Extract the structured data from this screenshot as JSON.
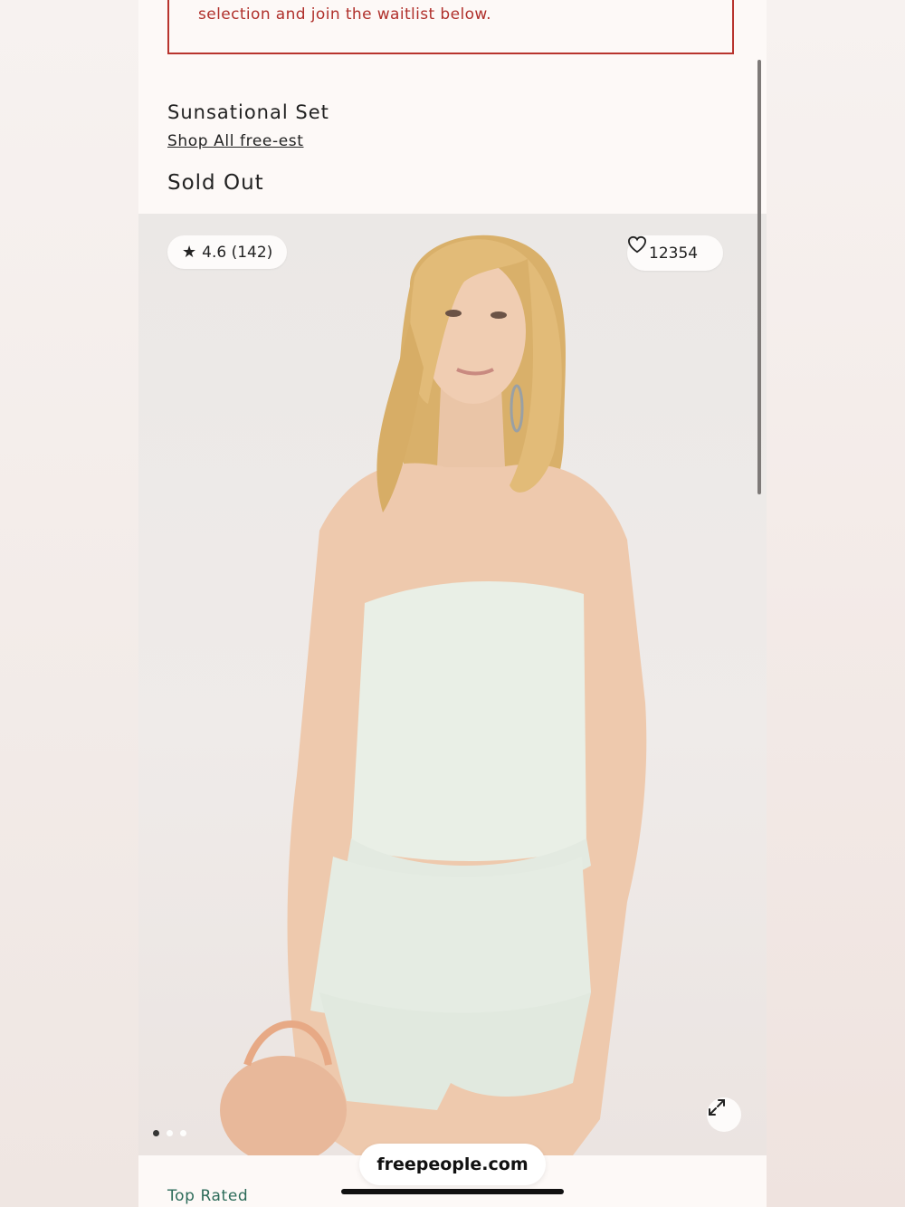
{
  "alert": {
    "text": "selection and join the waitlist below."
  },
  "product": {
    "title": "Sunsational Set",
    "brand_link": "Shop All free-est",
    "status": "Sold Out"
  },
  "gallery": {
    "rating": "4.6 (142)",
    "favorites_count": "12354",
    "icons": {
      "star": "star-icon",
      "heart": "heart-icon",
      "expand": "expand-icon"
    },
    "slide_count": 3,
    "active_slide": 1
  },
  "browser": {
    "url": "freepeople.com"
  },
  "section": {
    "badge": "Top Rated"
  },
  "colors": {
    "alert_border": "#b8342e",
    "alert_text": "#b0302b",
    "top_rated": "#2c6b59"
  }
}
